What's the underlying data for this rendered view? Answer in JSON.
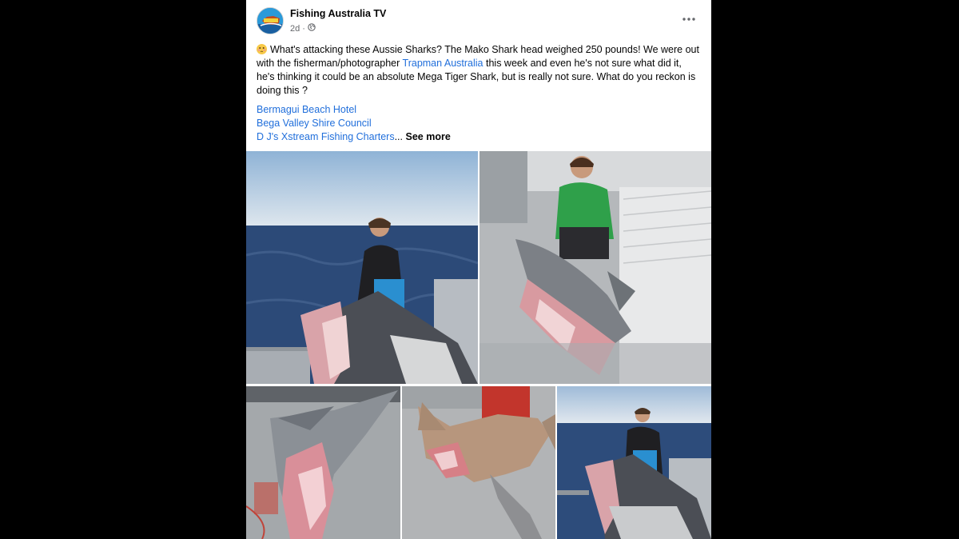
{
  "post": {
    "author": "Fishing Australia TV",
    "time": "2d",
    "text_before_link": "What's attacking these Aussie Sharks? The Mako Shark head weighed 250 pounds! We were out with the fisherman/photographer ",
    "link_trapman": "Trapman Australia",
    "text_after_link": " this week and even he's not sure what did it, he's thinking it could be an absolute Mega Tiger Shark, but is really not sure.  What do you reckon is doing this ?",
    "tag_1": "Bermagui Beach Hotel",
    "tag_2": "Bega Valley Shire Council",
    "tag_3": "D J's Xstream Fishing Charters",
    "ellipsis": "...",
    "see_more": "See more"
  },
  "icons": {
    "more": "more-options-icon",
    "globe": "globe-icon",
    "emoji": "flushed-face-emoji"
  },
  "colors": {
    "link": "#216fdb",
    "background": "#000000",
    "card": "#ffffff"
  }
}
